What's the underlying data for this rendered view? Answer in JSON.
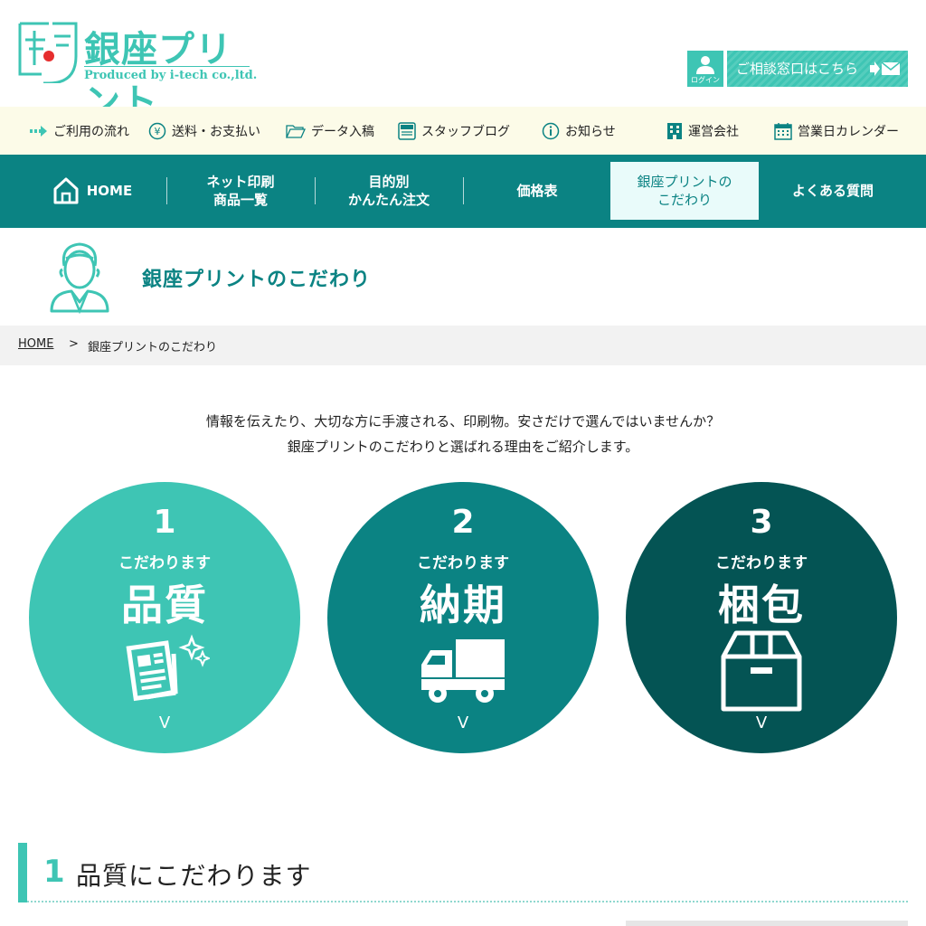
{
  "header": {
    "logo_text": "銀座プリント",
    "logo_sub": "Produced by i-tech co.,ltd.",
    "login_label": "ログイン",
    "consult_label": "ご相談窓口はこちら"
  },
  "subnav": {
    "items": [
      {
        "label": "ご利用の流れ",
        "icon": "arrow-right-icon"
      },
      {
        "label": "送料・お支払い",
        "icon": "yen-icon"
      },
      {
        "label": "データ入稿",
        "icon": "folder-icon"
      },
      {
        "label": "スタッフブログ",
        "icon": "blog-icon"
      },
      {
        "label": "お知らせ",
        "icon": "info-icon"
      },
      {
        "label": "運営会社",
        "icon": "building-icon"
      },
      {
        "label": "営業日カレンダー",
        "icon": "calendar-icon"
      }
    ]
  },
  "mainnav": {
    "items": [
      {
        "label": "HOME"
      },
      {
        "label": "ネット印刷\n商品一覧"
      },
      {
        "label": "目的別\nかんたん注文"
      },
      {
        "label": "価格表"
      },
      {
        "label": "銀座プリントの\nこだわり"
      },
      {
        "label": "よくある質問"
      }
    ],
    "active_index": 4
  },
  "page": {
    "title": "銀座プリントのこだわり"
  },
  "breadcrumb": {
    "home": "HOME",
    "separator": ">",
    "current": "銀座プリントのこだわり"
  },
  "intro": {
    "line1": "情報を伝えたり、大切な方に手渡される、印刷物。安さだけで選んではいませんか？",
    "line2": "銀座プリントのこだわりと選ばれる理由をご紹介します。"
  },
  "features": [
    {
      "num": "1",
      "small": "こだわります",
      "big": "品質",
      "chevron": "V",
      "color": "#3ec5b4",
      "icon": "document-sparkle-icon"
    },
    {
      "num": "2",
      "small": "こだわります",
      "big": "納期",
      "chevron": "V",
      "color": "#0b8383",
      "icon": "truck-icon"
    },
    {
      "num": "3",
      "small": "こだわります",
      "big": "梱包",
      "chevron": "V",
      "color": "#045454",
      "icon": "box-icon"
    }
  ],
  "section": {
    "num": "1",
    "title": "品質にこだわります"
  },
  "colors": {
    "accent": "#3ec5b4",
    "brand": "#0b8383",
    "dark": "#045454",
    "subnav_bg": "#fcfbe8"
  }
}
